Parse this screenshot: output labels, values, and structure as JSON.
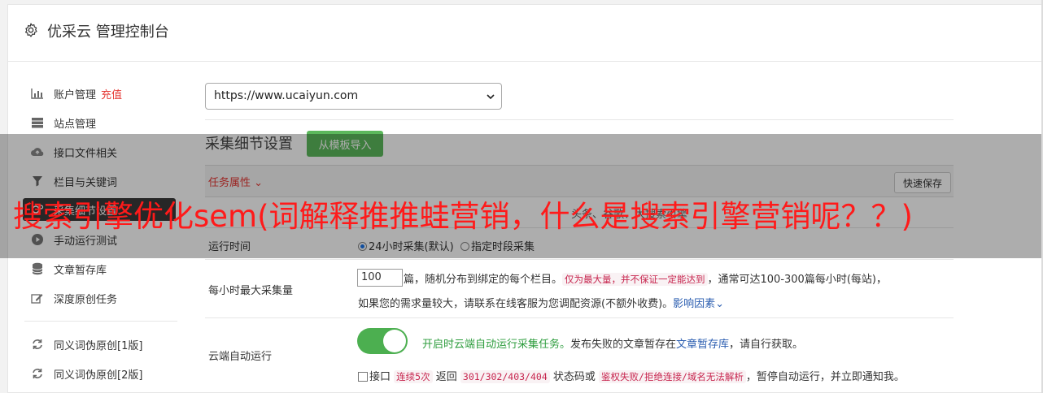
{
  "window": {
    "title": "优采云 管理控制台"
  },
  "sidebar": {
    "items": [
      {
        "label": "账户管理",
        "badge": "充值",
        "icon": "bar-chart-icon"
      },
      {
        "label": "站点管理",
        "icon": "server-icon"
      },
      {
        "label": "接口文件相关",
        "icon": "cloud-upload-icon"
      },
      {
        "label": "栏目与关键词",
        "icon": "filter-icon"
      },
      {
        "label": "采集细节设置",
        "icon": "gears-icon"
      },
      {
        "label": "手动运行测试",
        "icon": "play-circle-icon"
      },
      {
        "label": "文章暂存库",
        "icon": "database-icon"
      },
      {
        "label": "深度原创任务",
        "icon": "edit-icon"
      },
      {
        "label": "同义词伪原创[1版]",
        "icon": "refresh-icon"
      },
      {
        "label": "同义词伪原创[2版]",
        "icon": "refresh-icon"
      }
    ]
  },
  "site_select": {
    "value": "https://www.ucaiyun.com"
  },
  "settings": {
    "title": "采集细节设置",
    "import_button": "从模板导入",
    "task_attr_label": "任务属性",
    "quick_save": "快速保存",
    "source_row_partial": "头条、谷歌、大搜索引擎",
    "run_time": {
      "label": "运行时间",
      "option1": "24小时采集(默认)",
      "option2": "指定时段采集"
    },
    "max_per_hour": {
      "label": "每小时最大采集量",
      "value": "100",
      "desc1": "篇，随机分布到绑定的每个栏目。",
      "note": "仅为最大量，并不保证一定能达到",
      "desc2": "，通常可达100-300篇每小时(每站)，",
      "desc3": "如果您的需求量较大，请联系在线客服为您调配资源(不额外收费)。",
      "factors_link": "影响因素"
    },
    "cloud_run": {
      "label": "云端自动运行",
      "status_text": "开启时云端自动运行采集任务。",
      "desc_a": "发布失败的文章暂存在",
      "repo_link": "文章暂存库",
      "desc_b": "，请自行获取。",
      "chk_label": "接口",
      "code_consec": "连续5次",
      "ret_text": "返回",
      "code_status": "301/302/403/404",
      "status_or": "状态码或",
      "code_auth": "鉴权失败/拒绝连接/域名无法解析",
      "tail": "，暂停自动运行，并立即通知我。"
    }
  },
  "overlay": {
    "headline": "搜索引擎优化sem(词解释推推蛙营销，什么是搜索引擎营销呢？？)"
  },
  "colors": {
    "accent_green": "#5cb85c",
    "red": "#e53935",
    "toggle_green": "#4caf50"
  }
}
